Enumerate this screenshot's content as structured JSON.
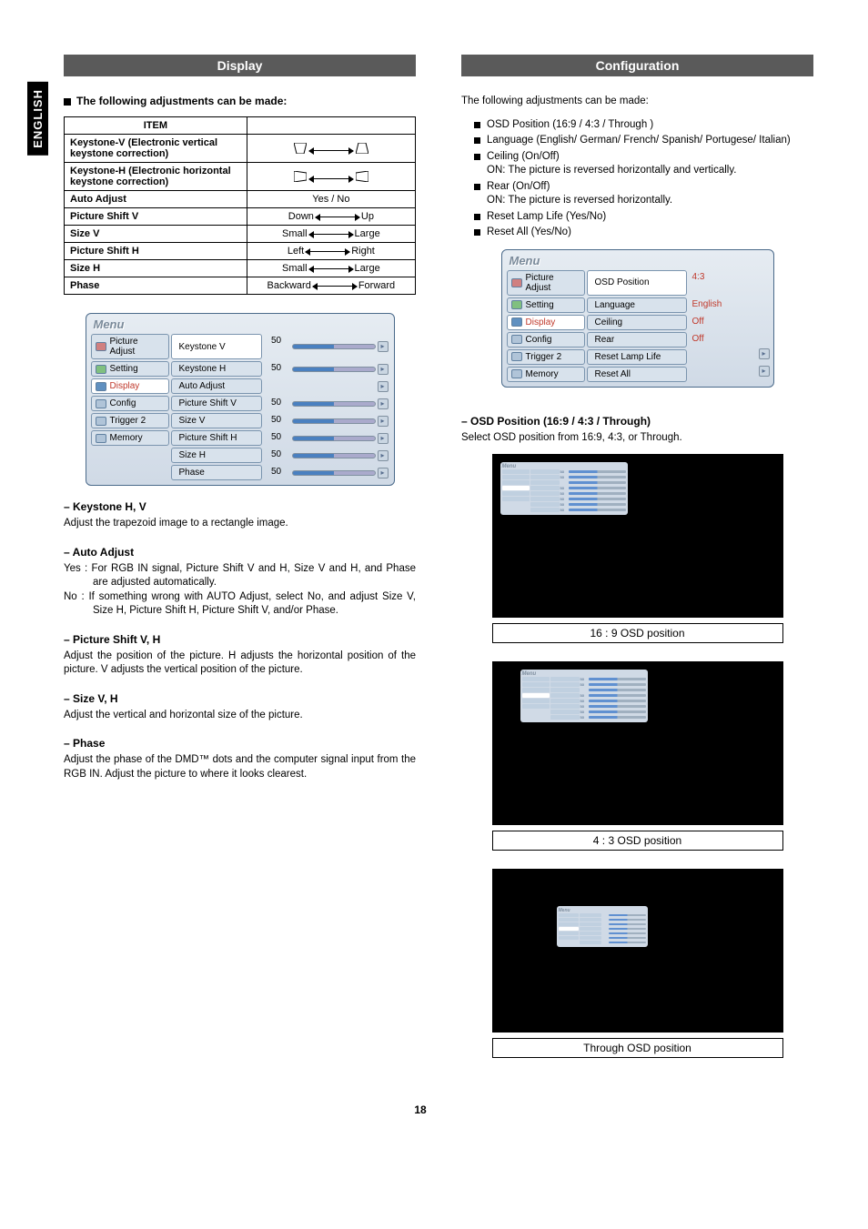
{
  "sidebar_lang": "ENGLISH",
  "left": {
    "header": "Display",
    "lead": "The following adjustments can be made:",
    "table": {
      "head": "ITEM",
      "rows": [
        {
          "label": "Keystone-V (Electronic vertical keystone correction)",
          "type": "shape-v"
        },
        {
          "label": "Keystone-H (Electronic horizontal keystone correction)",
          "type": "shape-h"
        },
        {
          "label": "Auto Adjust",
          "val": "Yes / No"
        },
        {
          "label": "Picture Shift V",
          "l": "Down",
          "r": "Up"
        },
        {
          "label": "Size V",
          "l": "Small",
          "r": "Large"
        },
        {
          "label": "Picture Shift H",
          "l": "Left",
          "r": "Right"
        },
        {
          "label": "Size H",
          "l": "Small",
          "r": "Large"
        },
        {
          "label": "Phase",
          "l": "Backward",
          "r": "Forward"
        }
      ]
    },
    "menu": {
      "title": "Menu",
      "nav": [
        "Picture Adjust",
        "Setting",
        "Display",
        "Config",
        "Trigger 2",
        "Memory"
      ],
      "items": [
        {
          "label": "Keystone V",
          "val": "50"
        },
        {
          "label": "Keystone H",
          "val": "50"
        },
        {
          "label": "Auto Adjust",
          "val": ""
        },
        {
          "label": "Picture Shift V",
          "val": "50"
        },
        {
          "label": "Size V",
          "val": "50"
        },
        {
          "label": "Picture Shift H",
          "val": "50"
        },
        {
          "label": "Size H",
          "val": "50"
        },
        {
          "label": "Phase",
          "val": "50"
        }
      ]
    },
    "sections": [
      {
        "h": "– Keystone H, V",
        "p": [
          "Adjust the trapezoid image to a rectangle image."
        ]
      },
      {
        "h": "– Auto Adjust",
        "hang": [
          {
            "k": "Yes :",
            "v": "For RGB IN signal, Picture Shift V and H, Size V and H, and Phase are adjusted automatically."
          },
          {
            "k": "No  :",
            "v": "If something wrong with AUTO Adjust, select No, and adjust Size V, Size H, Picture Shift H, Picture Shift V, and/or Phase."
          }
        ]
      },
      {
        "h": "– Picture Shift V, H",
        "p": [
          "Adjust the position of the picture. H adjusts the horizontal position of the picture. V adjusts the vertical position of the picture."
        ]
      },
      {
        "h": "– Size V, H",
        "p": [
          "Adjust the vertical and horizontal size of the picture."
        ]
      },
      {
        "h": "– Phase",
        "p": [
          "Adjust the phase of the DMD™ dots and the computer signal input from the RGB IN. Adjust the picture to where it looks clearest."
        ]
      }
    ]
  },
  "right": {
    "header": "Configuration",
    "lead": "The following adjustments can be made:",
    "bullets": [
      {
        "t": "OSD Position (16:9 / 4:3 / Through )"
      },
      {
        "t": "Language (English/ German/ French/ Spanish/ Portugese/ Italian)"
      },
      {
        "t": "Ceiling (On/Off)",
        "sub": "ON: The picture is reversed horizontally and vertically."
      },
      {
        "t": "Rear (On/Off)",
        "sub": "ON: The picture is reversed horizontally."
      },
      {
        "t": "Reset Lamp Life (Yes/No)"
      },
      {
        "t": "Reset All (Yes/No)"
      }
    ],
    "menu": {
      "title": "Menu",
      "nav": [
        "Picture Adjust",
        "Setting",
        "Display",
        "Config",
        "Trigger 2",
        "Memory"
      ],
      "items": [
        {
          "label": "OSD Position",
          "val": "4:3"
        },
        {
          "label": "Language",
          "val": "English"
        },
        {
          "label": "Ceiling",
          "val": "Off"
        },
        {
          "label": "Rear",
          "val": "Off"
        },
        {
          "label": "Reset Lamp Life",
          "btn": true
        },
        {
          "label": "Reset All",
          "btn": true
        }
      ]
    },
    "osd": {
      "h": "– OSD Position (16:9 / 4:3 / Through)",
      "p": "Select OSD position from 16:9, 4:3, or Through.",
      "captions": [
        "16 : 9  OSD position",
        "4 : 3  OSD position",
        "Through  OSD position"
      ]
    }
  },
  "page_number": "18"
}
